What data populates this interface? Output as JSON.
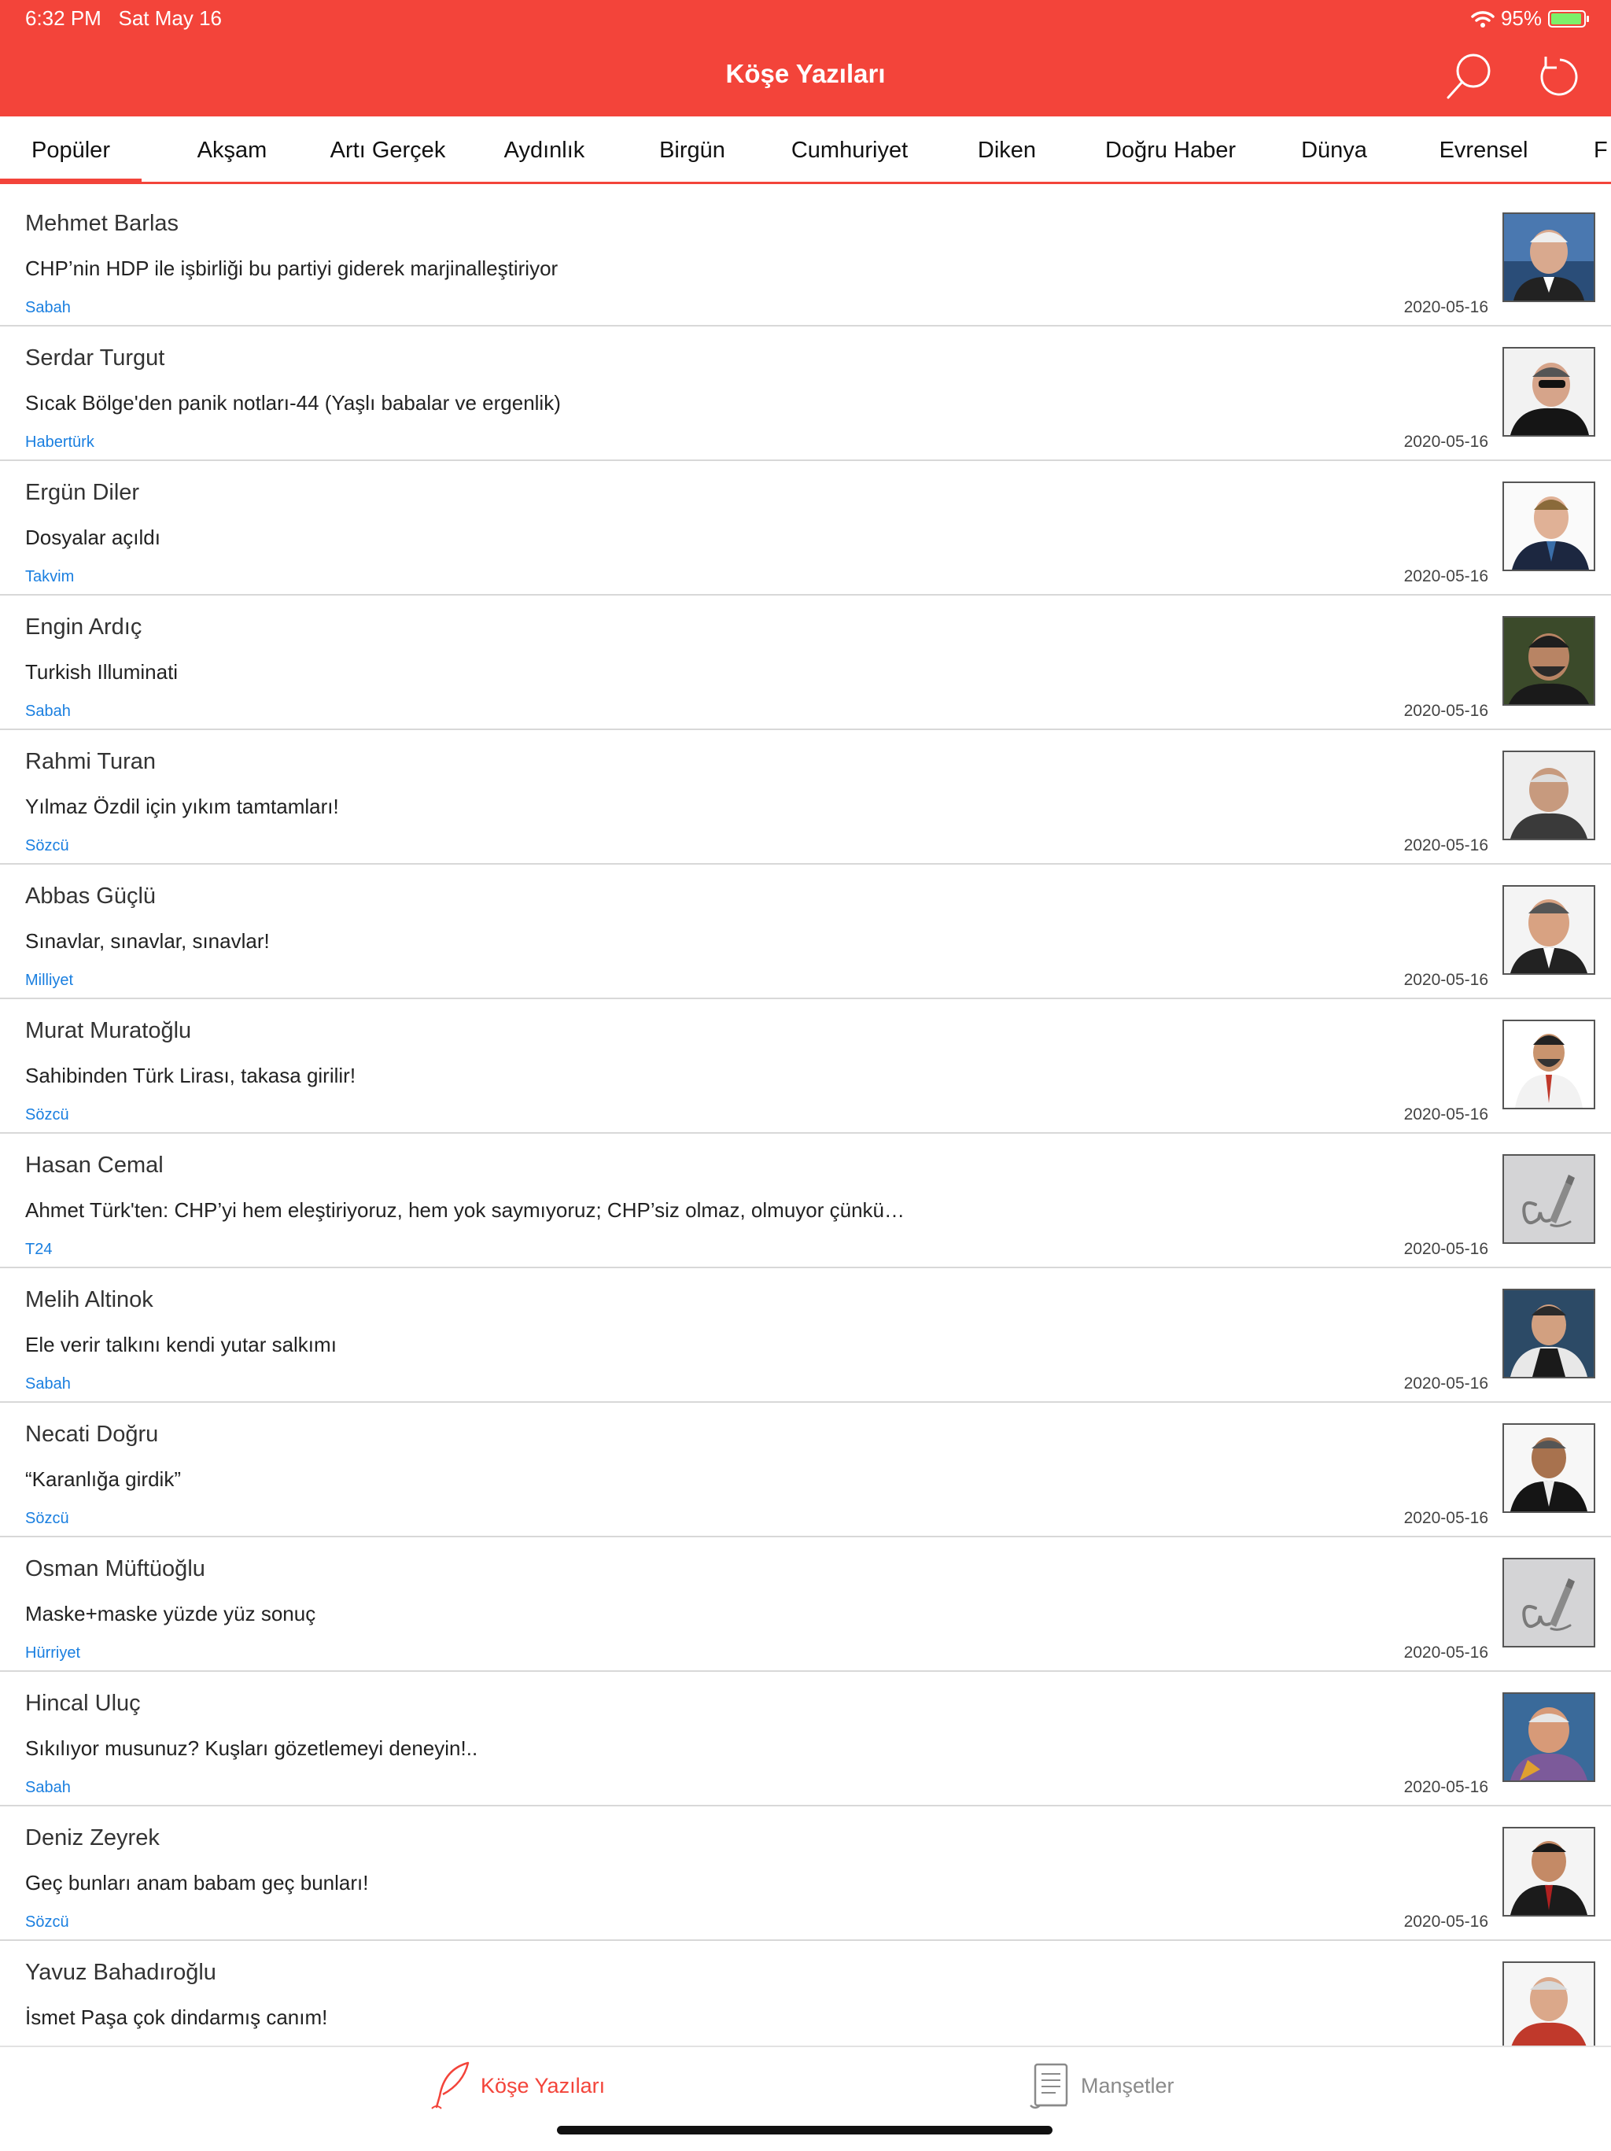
{
  "status": {
    "time": "6:32 PM",
    "date": "Sat May 16",
    "battery": "95%"
  },
  "nav": {
    "title": "Köşe Yazıları",
    "search_icon": "search-icon",
    "refresh_icon": "refresh-icon"
  },
  "colors": {
    "accent": "#f3443a",
    "link": "#1a7fe0"
  },
  "tabs": [
    "Popüler",
    "Akşam",
    "Artı Gerçek",
    "Aydınlık",
    "Birgün",
    "Cumhuriyet",
    "Diken",
    "Doğru Haber",
    "Dünya",
    "Evrensel",
    "F"
  ],
  "active_tab": "Popüler",
  "articles": [
    {
      "author": "Mehmet Barlas",
      "title": "CHP’nin HDP ile işbirliği bu partiyi giderek marjinalleştiriyor",
      "source": "Sabah",
      "date": "2020-05-16",
      "avatar": "photo"
    },
    {
      "author": "Serdar Turgut",
      "title": "Sıcak Bölge'den panik notları-44 (Yaşlı babalar ve ergenlik)",
      "source": "Habertürk",
      "date": "2020-05-16",
      "avatar": "photo"
    },
    {
      "author": "Ergün Diler",
      "title": "Dosyalar açıldı",
      "source": "Takvim",
      "date": "2020-05-16",
      "avatar": "photo"
    },
    {
      "author": "Engin Ardıç",
      "title": "Turkish Illuminati",
      "source": "Sabah",
      "date": "2020-05-16",
      "avatar": "photo"
    },
    {
      "author": "Rahmi Turan",
      "title": "Yılmaz Özdil için yıkım tamtamları!",
      "source": "Sözcü",
      "date": "2020-05-16",
      "avatar": "photo"
    },
    {
      "author": "Abbas Güçlü",
      "title": "Sınavlar, sınavlar, sınavlar!",
      "source": "Milliyet",
      "date": "2020-05-16",
      "avatar": "photo"
    },
    {
      "author": "Murat Muratoğlu",
      "title": "Sahibinden Türk Lirası, takasa girilir!",
      "source": "Sözcü",
      "date": "2020-05-16",
      "avatar": "photo"
    },
    {
      "author": "Hasan Cemal",
      "title": "Ahmet Türk'ten: CHP’yi hem eleştiriyoruz, hem yok saymıyoruz; CHP’siz olmaz, olmuyor çünkü…",
      "source": "T24",
      "date": "2020-05-16",
      "avatar": "placeholder"
    },
    {
      "author": "Melih Altinok",
      "title": "Ele verir talkını kendi yutar salkımı",
      "source": "Sabah",
      "date": "2020-05-16",
      "avatar": "photo"
    },
    {
      "author": "Necati Doğru",
      "title": "“Karanlığa girdik”",
      "source": "Sözcü",
      "date": "2020-05-16",
      "avatar": "photo"
    },
    {
      "author": "Osman Müftüoğlu",
      "title": "Maske+maske yüzde yüz sonuç",
      "source": "Hürriyet",
      "date": "2020-05-16",
      "avatar": "placeholder"
    },
    {
      "author": "Hincal Uluç",
      "title": "Sıkılıyor musunuz? Kuşları gözetlemeyi deneyin!..",
      "source": "Sabah",
      "date": "2020-05-16",
      "avatar": "photo"
    },
    {
      "author": "Deniz Zeyrek",
      "title": "Geç bunları anam babam geç bunları!",
      "source": "Sözcü",
      "date": "2020-05-16",
      "avatar": "photo"
    },
    {
      "author": "Yavuz Bahadıroğlu",
      "title": "İsmet Paşa çok dindarmış canım!",
      "source": "",
      "date": "",
      "avatar": "photo"
    }
  ],
  "bottom_tabs": [
    {
      "label": "Köşe Yazıları",
      "icon": "quill-icon",
      "active": true
    },
    {
      "label": "Manşetler",
      "icon": "scroll-icon",
      "active": false
    }
  ]
}
